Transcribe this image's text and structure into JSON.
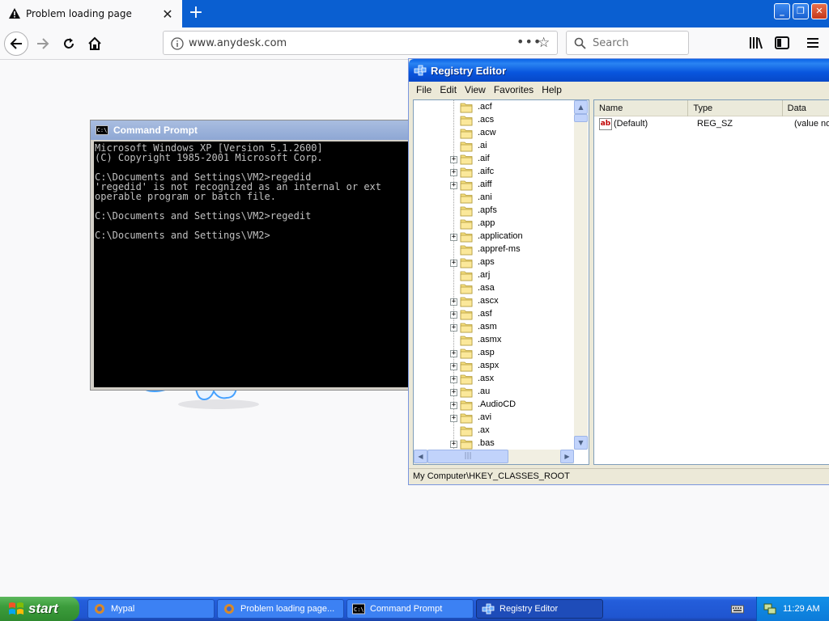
{
  "browser": {
    "tab_title": "Problem loading page",
    "url": "www.anydesk.com",
    "search_placeholder": "Search",
    "page_actions": "•••"
  },
  "cmd": {
    "title": "Command Prompt",
    "icon_text": "C:\\",
    "lines": [
      "Microsoft Windows XP [Version 5.1.2600]",
      "(C) Copyright 1985-2001 Microsoft Corp.",
      "",
      "C:\\Documents and Settings\\VM2>regedid",
      "'regedid' is not recognized as an internal or ext",
      "operable program or batch file.",
      "",
      "C:\\Documents and Settings\\VM2>regedit",
      "",
      "C:\\Documents and Settings\\VM2>"
    ]
  },
  "regedit": {
    "title": "Registry Editor",
    "menu": [
      "File",
      "Edit",
      "View",
      "Favorites",
      "Help"
    ],
    "tree": [
      {
        "label": ".acf",
        "expandable": false
      },
      {
        "label": ".acs",
        "expandable": false
      },
      {
        "label": ".acw",
        "expandable": false
      },
      {
        "label": ".ai",
        "expandable": false
      },
      {
        "label": ".aif",
        "expandable": true
      },
      {
        "label": ".aifc",
        "expandable": true
      },
      {
        "label": ".aiff",
        "expandable": true
      },
      {
        "label": ".ani",
        "expandable": false
      },
      {
        "label": ".apfs",
        "expandable": false
      },
      {
        "label": ".app",
        "expandable": false
      },
      {
        "label": ".application",
        "expandable": true
      },
      {
        "label": ".appref-ms",
        "expandable": false
      },
      {
        "label": ".aps",
        "expandable": true
      },
      {
        "label": ".arj",
        "expandable": false
      },
      {
        "label": ".asa",
        "expandable": false
      },
      {
        "label": ".ascx",
        "expandable": true
      },
      {
        "label": ".asf",
        "expandable": true
      },
      {
        "label": ".asm",
        "expandable": true
      },
      {
        "label": ".asmx",
        "expandable": false
      },
      {
        "label": ".asp",
        "expandable": true
      },
      {
        "label": ".aspx",
        "expandable": true
      },
      {
        "label": ".asx",
        "expandable": true
      },
      {
        "label": ".au",
        "expandable": true
      },
      {
        "label": ".AudioCD",
        "expandable": true
      },
      {
        "label": ".avi",
        "expandable": true
      },
      {
        "label": ".ax",
        "expandable": false
      },
      {
        "label": ".bas",
        "expandable": true
      }
    ],
    "columns": [
      "Name",
      "Type",
      "Data"
    ],
    "values": [
      {
        "name": "(Default)",
        "type": "REG_SZ",
        "data": "(value not"
      }
    ],
    "value_icon": "ab",
    "status": "My Computer\\HKEY_CLASSES_ROOT"
  },
  "taskbar": {
    "start_label": "start",
    "buttons": [
      "Mypal",
      "Problem loading page...",
      "Command Prompt",
      "Registry Editor"
    ],
    "clock": "11:29 AM"
  },
  "colors": {
    "xp_blue": "#245edb",
    "firefox_blue": "#0a5fd1",
    "start_green": "#3c9d3c"
  }
}
